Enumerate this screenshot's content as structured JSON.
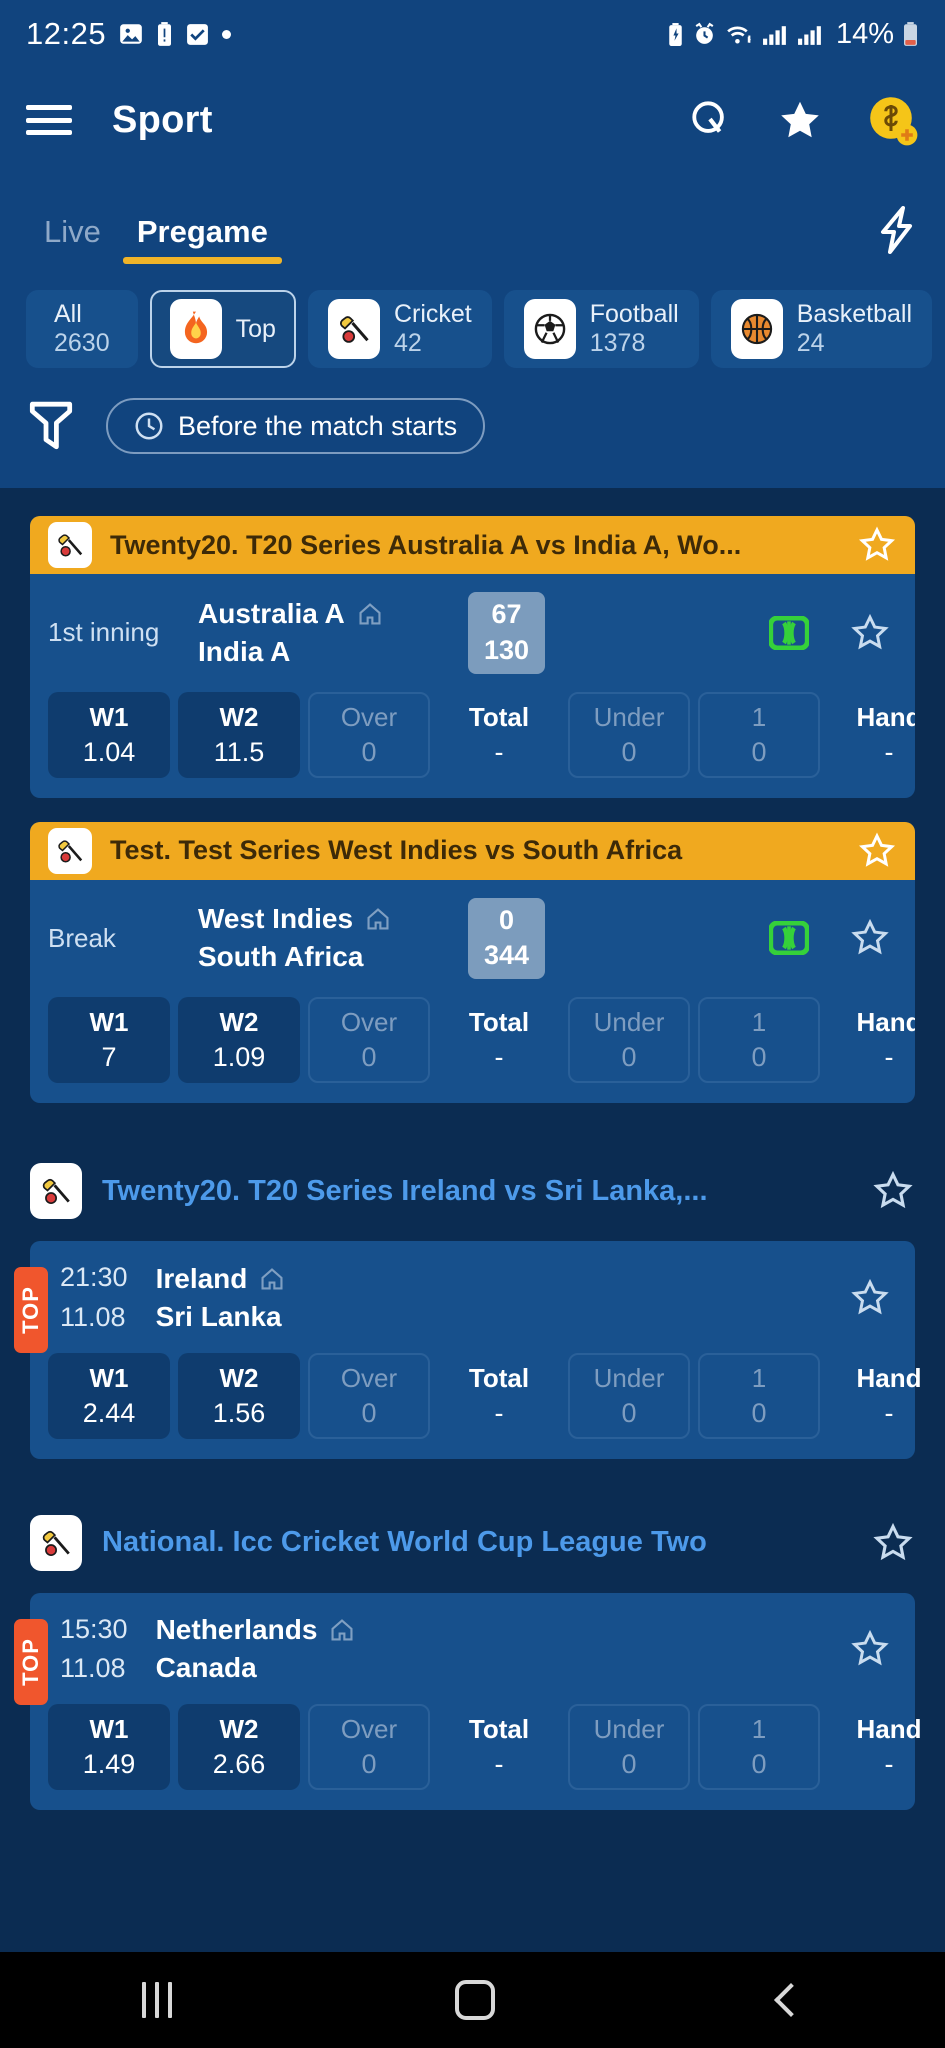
{
  "status_bar": {
    "time": "12:25",
    "battery_percent": "14%",
    "left_icons": [
      "photo-icon",
      "battery-alert-icon",
      "task-check-icon",
      "dot-icon"
    ],
    "right_icons": [
      "battery-saver-icon",
      "alarm-icon",
      "wifi-icon",
      "signal-bars-icon",
      "signal-bars-2-icon",
      "battery-icon"
    ]
  },
  "app_bar": {
    "title": "Sport",
    "menu_icon": "hamburger-menu-icon",
    "actions": [
      "search-icon",
      "favorites-star-icon",
      "add-funds-coin-icon"
    ]
  },
  "tabs": {
    "items": [
      {
        "label": "Live",
        "active": false
      },
      {
        "label": "Pregame",
        "active": true
      }
    ],
    "quick_bet_icon": "lightning-bolt-icon",
    "active_underline_color": "#f0b429"
  },
  "sport_chips": [
    {
      "name": "All",
      "count": "2630",
      "icon": "",
      "selected": false
    },
    {
      "name": "Top",
      "count": "",
      "icon": "fire-icon",
      "selected": true
    },
    {
      "name": "Cricket",
      "count": "42",
      "icon": "cricket-icon",
      "selected": false
    },
    {
      "name": "Football",
      "count": "1378",
      "icon": "football-icon",
      "selected": false
    },
    {
      "name": "Basketball",
      "count": "24",
      "icon": "basketball-icon",
      "selected": false
    }
  ],
  "filters": {
    "filter_icon": "funnel-filter-icon",
    "time_pill_label": "Before the match starts",
    "time_pill_icon": "clock-icon"
  },
  "odds_columns": [
    "W1",
    "W2",
    "Over",
    "Total",
    "Under",
    "1",
    "Hand"
  ],
  "live_groups": [
    {
      "header_title": "Twenty20. T20 Series Australia A vs India A, Wo...",
      "header_icon": "cricket-icon",
      "header_star": "star-outline-icon",
      "match": {
        "status": "1st inning",
        "home_team": "Australia A",
        "away_team": "India A",
        "home_indicator_icon": "home-icon",
        "score_home": "67",
        "score_away": "130",
        "stats_icon": "pitch-stats-icon",
        "star_icon": "star-outline-icon",
        "odds": [
          {
            "key": "W1",
            "value": "1.04",
            "state": "active"
          },
          {
            "key": "W2",
            "value": "11.5",
            "state": "active"
          },
          {
            "key": "Over",
            "value": "0",
            "state": "dim"
          },
          {
            "key": "Total",
            "value": "-",
            "state": "bare"
          },
          {
            "key": "Under",
            "value": "0",
            "state": "dim"
          },
          {
            "key": "1",
            "value": "0",
            "state": "dim"
          },
          {
            "key": "Hand",
            "value": "-",
            "state": "bare"
          }
        ]
      }
    },
    {
      "header_title": "Test. Test Series West Indies vs South Africa",
      "header_icon": "cricket-icon",
      "header_star": "star-outline-icon",
      "match": {
        "status": "Break",
        "home_team": "West Indies",
        "away_team": "South Africa",
        "home_indicator_icon": "home-icon",
        "score_home": "0",
        "score_away": "344",
        "stats_icon": "pitch-stats-icon",
        "star_icon": "star-outline-icon",
        "odds": [
          {
            "key": "W1",
            "value": "7",
            "state": "active"
          },
          {
            "key": "W2",
            "value": "1.09",
            "state": "active"
          },
          {
            "key": "Over",
            "value": "0",
            "state": "dim"
          },
          {
            "key": "Total",
            "value": "-",
            "state": "bare"
          },
          {
            "key": "Under",
            "value": "0",
            "state": "dim"
          },
          {
            "key": "1",
            "value": "0",
            "state": "dim"
          },
          {
            "key": "Hand",
            "value": "-",
            "state": "bare"
          }
        ]
      }
    }
  ],
  "pregame_groups": [
    {
      "title": "Twenty20. T20 Series Ireland vs Sri Lanka,...",
      "icon": "cricket-icon",
      "star": "star-outline-icon",
      "match": {
        "badge": "TOP",
        "time": "21:30",
        "date": "11.08",
        "home_team": "Ireland",
        "away_team": "Sri Lanka",
        "home_indicator_icon": "home-icon",
        "star_icon": "star-outline-icon",
        "odds": [
          {
            "key": "W1",
            "value": "2.44",
            "state": "active"
          },
          {
            "key": "W2",
            "value": "1.56",
            "state": "active"
          },
          {
            "key": "Over",
            "value": "0",
            "state": "dim"
          },
          {
            "key": "Total",
            "value": "-",
            "state": "bare"
          },
          {
            "key": "Under",
            "value": "0",
            "state": "dim"
          },
          {
            "key": "1",
            "value": "0",
            "state": "dim"
          },
          {
            "key": "Hand",
            "value": "-",
            "state": "bare"
          }
        ]
      }
    },
    {
      "title": "National. Icc Cricket World Cup League Two",
      "icon": "cricket-icon",
      "star": "star-outline-icon",
      "match": {
        "badge": "TOP",
        "time": "15:30",
        "date": "11.08",
        "home_team": "Netherlands",
        "away_team": "Canada",
        "home_indicator_icon": "home-icon",
        "star_icon": "star-outline-icon",
        "odds": [
          {
            "key": "W1",
            "value": "1.49",
            "state": "active"
          },
          {
            "key": "W2",
            "value": "2.66",
            "state": "active"
          },
          {
            "key": "Over",
            "value": "0",
            "state": "dim"
          },
          {
            "key": "Total",
            "value": "-",
            "state": "bare"
          },
          {
            "key": "Under",
            "value": "0",
            "state": "dim"
          },
          {
            "key": "1",
            "value": "0",
            "state": "dim"
          },
          {
            "key": "Hand",
            "value": "-",
            "state": "bare"
          }
        ]
      }
    }
  ],
  "nav_bar": {
    "recents_icon": "recents-icon",
    "home_icon": "home-square-icon",
    "back_icon": "back-chevron-icon"
  },
  "colors": {
    "header_blue": "#11447e",
    "page_blue": "#0b2c52",
    "card_blue": "#17508c",
    "live_header_orange": "#f0a91f",
    "accent_yellow": "#f0b429",
    "top_badge_orange": "#f0562d",
    "link_blue": "#4d9aea",
    "score_bg": "#7c9cbd"
  }
}
